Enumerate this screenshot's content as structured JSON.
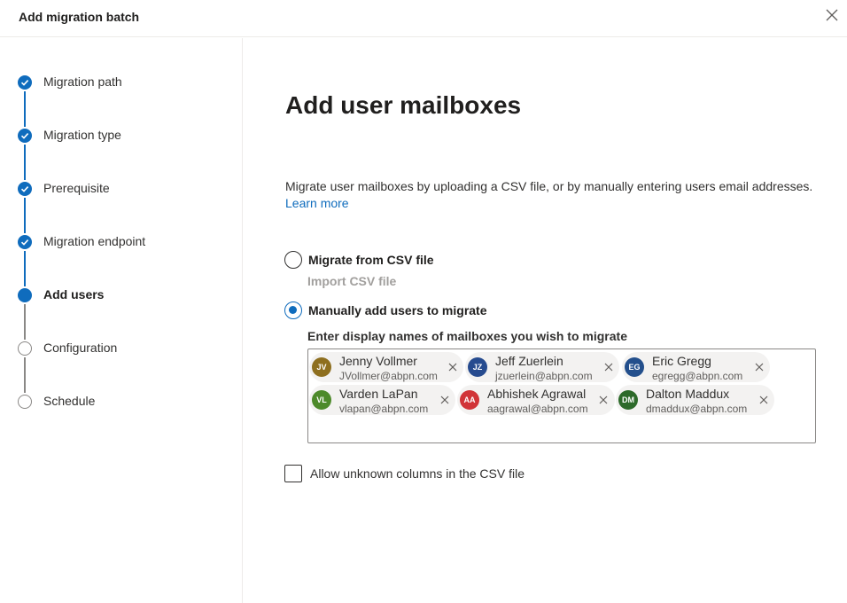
{
  "header": {
    "title": "Add migration batch"
  },
  "steps": [
    {
      "label": "Migration path",
      "state": "done"
    },
    {
      "label": "Migration type",
      "state": "done"
    },
    {
      "label": "Prerequisite",
      "state": "done"
    },
    {
      "label": "Migration endpoint",
      "state": "done"
    },
    {
      "label": "Add users",
      "state": "current"
    },
    {
      "label": "Configuration",
      "state": "todo"
    },
    {
      "label": "Schedule",
      "state": "todo"
    }
  ],
  "main": {
    "title": "Add user mailboxes",
    "description": "Migrate user mailboxes by uploading a CSV file, or by manually entering users email addresses.",
    "learn_more": "Learn more",
    "option_csv": "Migrate from CSV file",
    "import_csv": "Import CSV file",
    "option_manual": "Manually add users to migrate",
    "picker_label": "Enter display names of mailboxes you wish to migrate",
    "checkbox_label": "Allow unknown columns in the CSV file"
  },
  "users": [
    {
      "initials": "JV",
      "name": "Jenny Vollmer",
      "email": "JVollmer@abpn.com",
      "color": "#8e6f1f"
    },
    {
      "initials": "JZ",
      "name": "Jeff Zuerlein",
      "email": "jzuerlein@abpn.com",
      "color": "#264b8f"
    },
    {
      "initials": "EG",
      "name": "Eric Gregg",
      "email": "egregg@abpn.com",
      "color": "#234f8c"
    },
    {
      "initials": "VL",
      "name": "Varden LaPan",
      "email": "vlapan@abpn.com",
      "color": "#4d8a2a"
    },
    {
      "initials": "AA",
      "name": "Abhishek Agrawal",
      "email": "aagrawal@abpn.com",
      "color": "#d13438"
    },
    {
      "initials": "DM",
      "name": "Dalton Maddux",
      "email": "dmaddux@abpn.com",
      "color": "#2d6a2a"
    }
  ],
  "colors": {
    "accent": "#0f6cbd",
    "border": "#8a8886",
    "chip_bg": "#f3f2f1"
  }
}
